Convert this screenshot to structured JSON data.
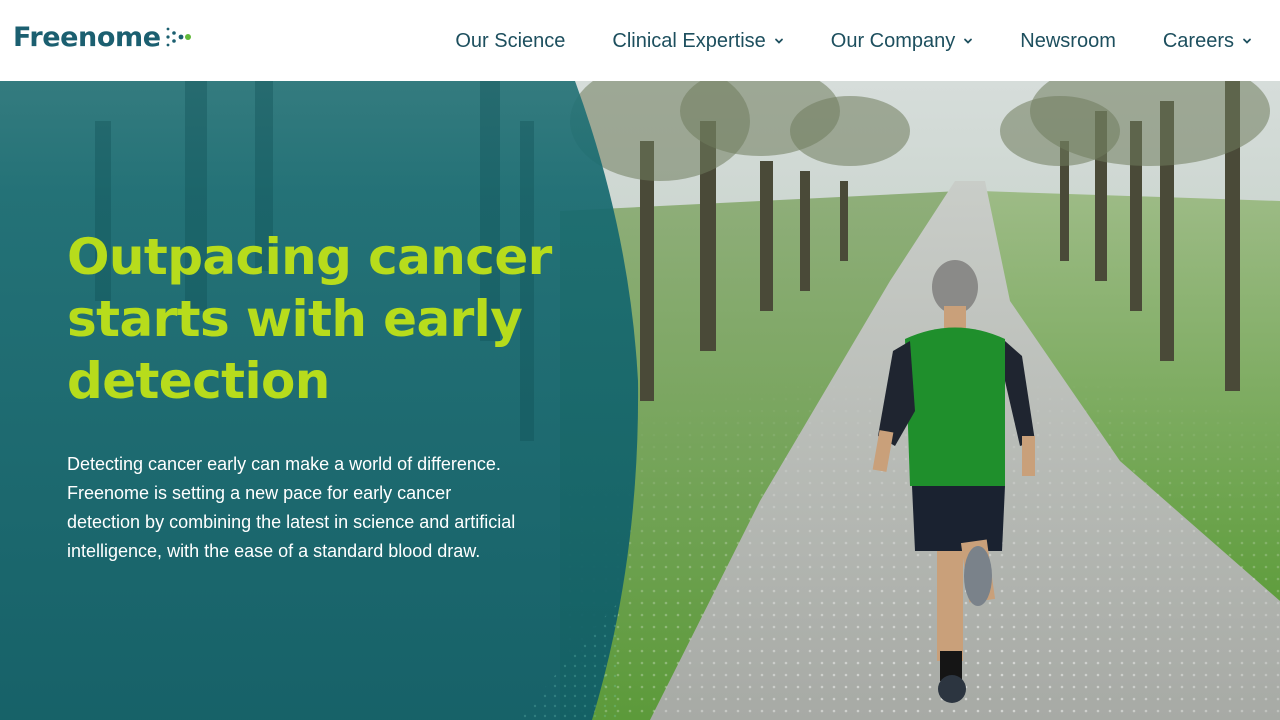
{
  "header": {
    "logo_text": "Freenome",
    "nav": [
      {
        "label": "Our Science",
        "has_dropdown": false
      },
      {
        "label": "Clinical Expertise",
        "has_dropdown": true
      },
      {
        "label": "Our Company",
        "has_dropdown": true
      },
      {
        "label": "Newsroom",
        "has_dropdown": false
      },
      {
        "label": "Careers",
        "has_dropdown": true
      }
    ]
  },
  "hero": {
    "headline": "Outpacing cancer starts with early detection",
    "body": "Detecting cancer early can make a world of difference. Freenome is setting a new pace for early cancer detection by combining the latest in science and artificial intelligence, with the ease of a standard blood draw."
  },
  "colors": {
    "brand_teal": "#1b5f70",
    "nav_text": "#1d4f5e",
    "headline_lime": "#b7dc1c",
    "panel_teal": "#135e66"
  }
}
